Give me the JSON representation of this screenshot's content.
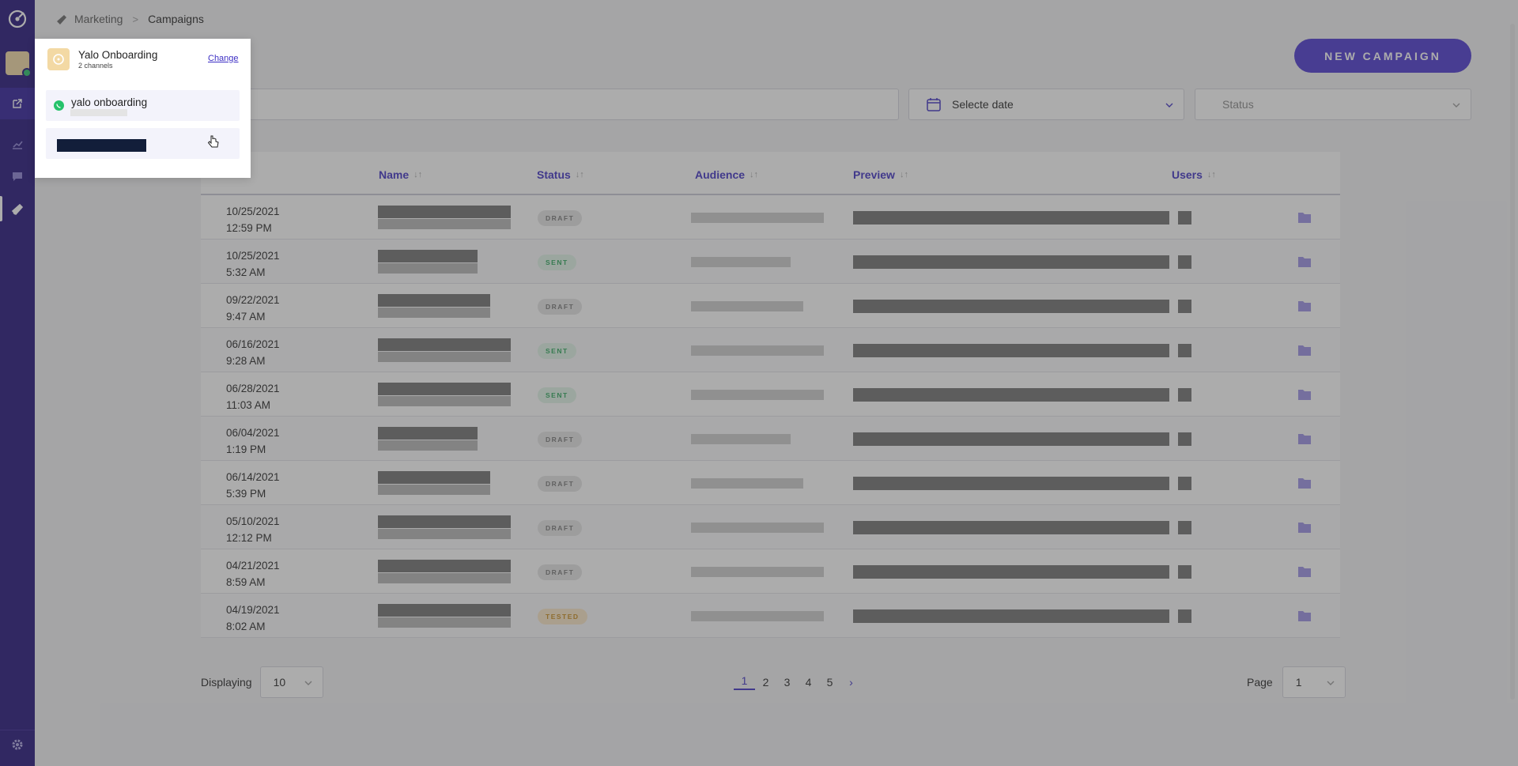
{
  "breadcrumb": {
    "section": "Marketing",
    "page": "Campaigns"
  },
  "actions": {
    "new_campaign": "NEW CAMPAIGN"
  },
  "filters": {
    "date_placeholder": "Selecte date",
    "status_placeholder": "Status"
  },
  "table": {
    "headers": {
      "name": "Name",
      "status": "Status",
      "audience": "Audience",
      "preview": "Preview",
      "users": "Users"
    },
    "rows": [
      {
        "date": "10/25/2021",
        "time": "12:59 PM",
        "status": "DRAFT"
      },
      {
        "date": "10/25/2021",
        "time": "5:32 AM",
        "status": "SENT"
      },
      {
        "date": "09/22/2021",
        "time": "9:47 AM",
        "status": "DRAFT"
      },
      {
        "date": "06/16/2021",
        "time": "9:28 AM",
        "status": "SENT"
      },
      {
        "date": "06/28/2021",
        "time": "11:03 AM",
        "status": "SENT"
      },
      {
        "date": "06/04/2021",
        "time": "1:19 PM",
        "status": "DRAFT"
      },
      {
        "date": "06/14/2021",
        "time": "5:39 PM",
        "status": "DRAFT"
      },
      {
        "date": "05/10/2021",
        "time": "12:12 PM",
        "status": "DRAFT"
      },
      {
        "date": "04/21/2021",
        "time": "8:59 AM",
        "status": "DRAFT"
      },
      {
        "date": "04/19/2021",
        "time": "8:02 AM",
        "status": "TESTED"
      }
    ]
  },
  "pagination": {
    "displaying_label": "Displaying",
    "per_page": "10",
    "pages": [
      "1",
      "2",
      "3",
      "4",
      "5"
    ],
    "current_page": "1",
    "page_label": "Page",
    "page_value": "1"
  },
  "account_popup": {
    "account_name": "Yalo Onboarding",
    "channels_count": "2 channels",
    "change_label": "Change",
    "channels": [
      {
        "name": "yalo onboarding",
        "icon": "whatsapp-icon"
      }
    ]
  },
  "colors": {
    "sidebar": "#1f0f78",
    "accent": "#4a35d0",
    "sent": "#2aa65a",
    "tested": "#c98a1b",
    "draft": "#777777"
  }
}
